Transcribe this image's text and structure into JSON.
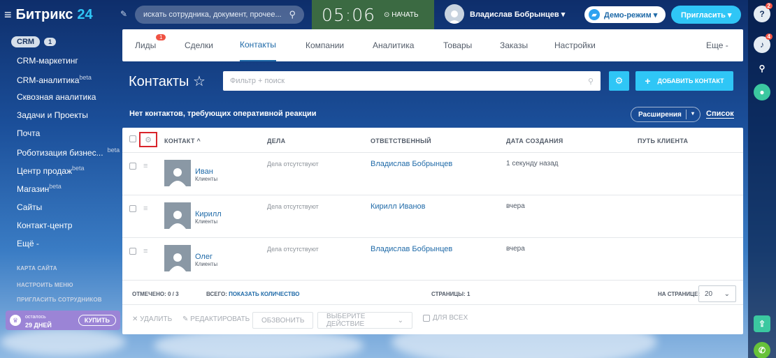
{
  "header": {
    "logo_text": "Битрикс",
    "logo_num": "24",
    "search_placeholder": "искать сотрудника, документ, прочее...",
    "clock_time": "05:06",
    "clock_start": "⊙ НАЧАТЬ",
    "user_name": "Владислав Бобрынцев ▾",
    "demo_label": "Демо-режим ▾",
    "invite_label": "Пригласить ▾"
  },
  "rail": {
    "help_badge": "2",
    "bell_badge": "4"
  },
  "sidebar": {
    "crm_label": "CRM",
    "crm_count": "1",
    "items": [
      {
        "label": "CRM-маркетинг",
        "sup": ""
      },
      {
        "label": "CRM-аналитика",
        "sup": "beta"
      },
      {
        "label": "Сквозная аналитика",
        "sup": ""
      },
      {
        "label": "Задачи и Проекты",
        "sup": ""
      },
      {
        "label": "Почта",
        "sup": ""
      },
      {
        "label": "Роботизация бизнес...",
        "sup": "beta"
      },
      {
        "label": "Центр продаж",
        "sup": "beta"
      },
      {
        "label": "Магазин",
        "sup": "beta"
      },
      {
        "label": "Сайты",
        "sup": ""
      },
      {
        "label": "Контакт-центр",
        "sup": ""
      },
      {
        "label": "Ещё -",
        "sup": ""
      }
    ],
    "small_links": [
      "КАРТА САЙТА",
      "НАСТРОИТЬ МЕНЮ",
      "ПРИГЛАСИТЬ СОТРУДНИКОВ"
    ],
    "trial_small": "осталось",
    "trial_days": "29 ДНЕЙ",
    "buy_label": "КУПИТЬ"
  },
  "tabs": [
    {
      "label": "Лиды",
      "badge": "1"
    },
    {
      "label": "Сделки",
      "badge": ""
    },
    {
      "label": "Контакты",
      "badge": ""
    },
    {
      "label": "Компании",
      "badge": ""
    },
    {
      "label": "Аналитика",
      "badge": ""
    },
    {
      "label": "Товары",
      "badge": ""
    },
    {
      "label": "Заказы",
      "badge": ""
    },
    {
      "label": "Настройки",
      "badge": ""
    },
    {
      "label": "Еще -",
      "badge": ""
    }
  ],
  "page": {
    "title": "Контакты ☆",
    "filter_placeholder": "Фильтр + поиск",
    "add_contact": "ДОБАВИТЬ КОНТАКТ",
    "notice": "Нет контактов, требующих оперативной реакции",
    "extensions": "Расширения",
    "list_view": "Список"
  },
  "table": {
    "columns": [
      "КОНТАКТ ^",
      "ДЕЛА",
      "ОТВЕТСТВЕННЫЙ",
      "ДАТА СОЗДАНИЯ",
      "ПУТЬ КЛИЕНТА"
    ],
    "rows": [
      {
        "name": "Иван",
        "type": "Клиенты",
        "deals": "Дела отсутствуют",
        "responsible": "Владислав Бобрынцев",
        "created": "1 секунду назад"
      },
      {
        "name": "Кирилл",
        "type": "Клиенты",
        "deals": "Дела отсутствуют",
        "responsible": "Кирилл Иванов",
        "created": "вчера"
      },
      {
        "name": "Олег",
        "type": "Клиенты",
        "deals": "Дела отсутствуют",
        "responsible": "Владислав Бобрынцев",
        "created": "вчера"
      }
    ],
    "marked": "ОТМЕЧЕНО: 0 / 3",
    "total_label": "ВСЕГО:",
    "total_link": "ПОКАЗАТЬ КОЛИЧЕСТВО",
    "pages": "СТРАНИЦЫ: 1",
    "per_page_label": "НА СТРАНИЦЕ:",
    "per_page_value": "20"
  },
  "actions": {
    "delete": "✕ УДАЛИТЬ",
    "edit": "✎ РЕДАКТИРОВАТЬ",
    "call": "ОБЗВОНИТЬ",
    "choose": "ВЫБЕРИТЕ ДЕЙСТВИЕ",
    "for_all": "ДЛЯ ВСЕХ"
  }
}
